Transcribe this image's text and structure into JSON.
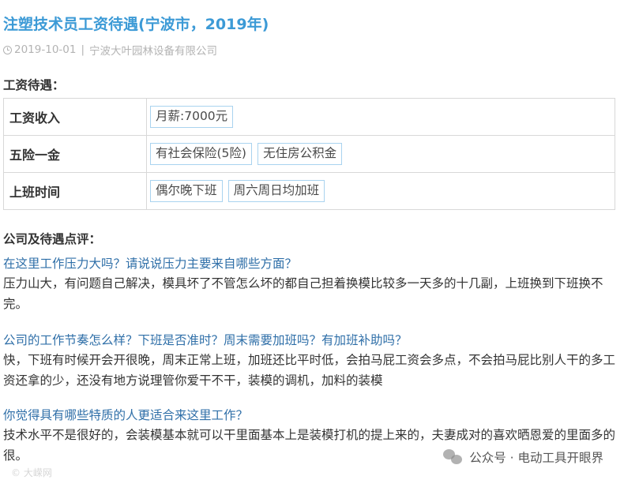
{
  "title": "注塑技术员工资待遇(宁波市，2019年)",
  "meta": {
    "date": "2019-10-01",
    "separator": "|",
    "company": "宁波大叶园林设备有限公司"
  },
  "salary_section": {
    "heading": "工资待遇：",
    "rows": [
      {
        "label": "工资收入",
        "tags": [
          "月薪:7000元"
        ]
      },
      {
        "label": "五险一金",
        "tags": [
          "有社会保险(5险)",
          "无住房公积金"
        ]
      },
      {
        "label": "上班时间",
        "tags": [
          "偶尔晚下班",
          "周六周日均加班"
        ]
      }
    ]
  },
  "review_section": {
    "heading": "公司及待遇点评：",
    "qa": [
      {
        "question": "在这里工作压力大吗？请说说压力主要来自哪些方面？",
        "answer": "压力山大，有问题自己解决，模具坏了不管怎么坏的都自己担着换模比较多一天多的十几副，上班换到下班换不完。"
      },
      {
        "question": "公司的工作节奏怎么样？下班是否准时？周末需要加班吗？有加班补助吗？",
        "answer": "快，下班有时候开会开很晚，周末正常上班，加班还比平时低，会拍马屁工资会多点，不会拍马屁比别人干的多工资还拿的少，还没有地方说理管你爱干不干，装模的调机，加料的装模"
      },
      {
        "question": "你觉得具有哪些特质的人更适合来这里工作？",
        "answer": "技术水平不是很好的，会装模基本就可以干里面基本上是装模打机的提上来的，夫妻成对的喜欢晒恩爱的里面多的很。"
      }
    ]
  },
  "watermark": {
    "text": "公众号 · 电动工具开眼界",
    "icon": "wechat-icon"
  },
  "bottom_mark": "© 大嵘网"
}
